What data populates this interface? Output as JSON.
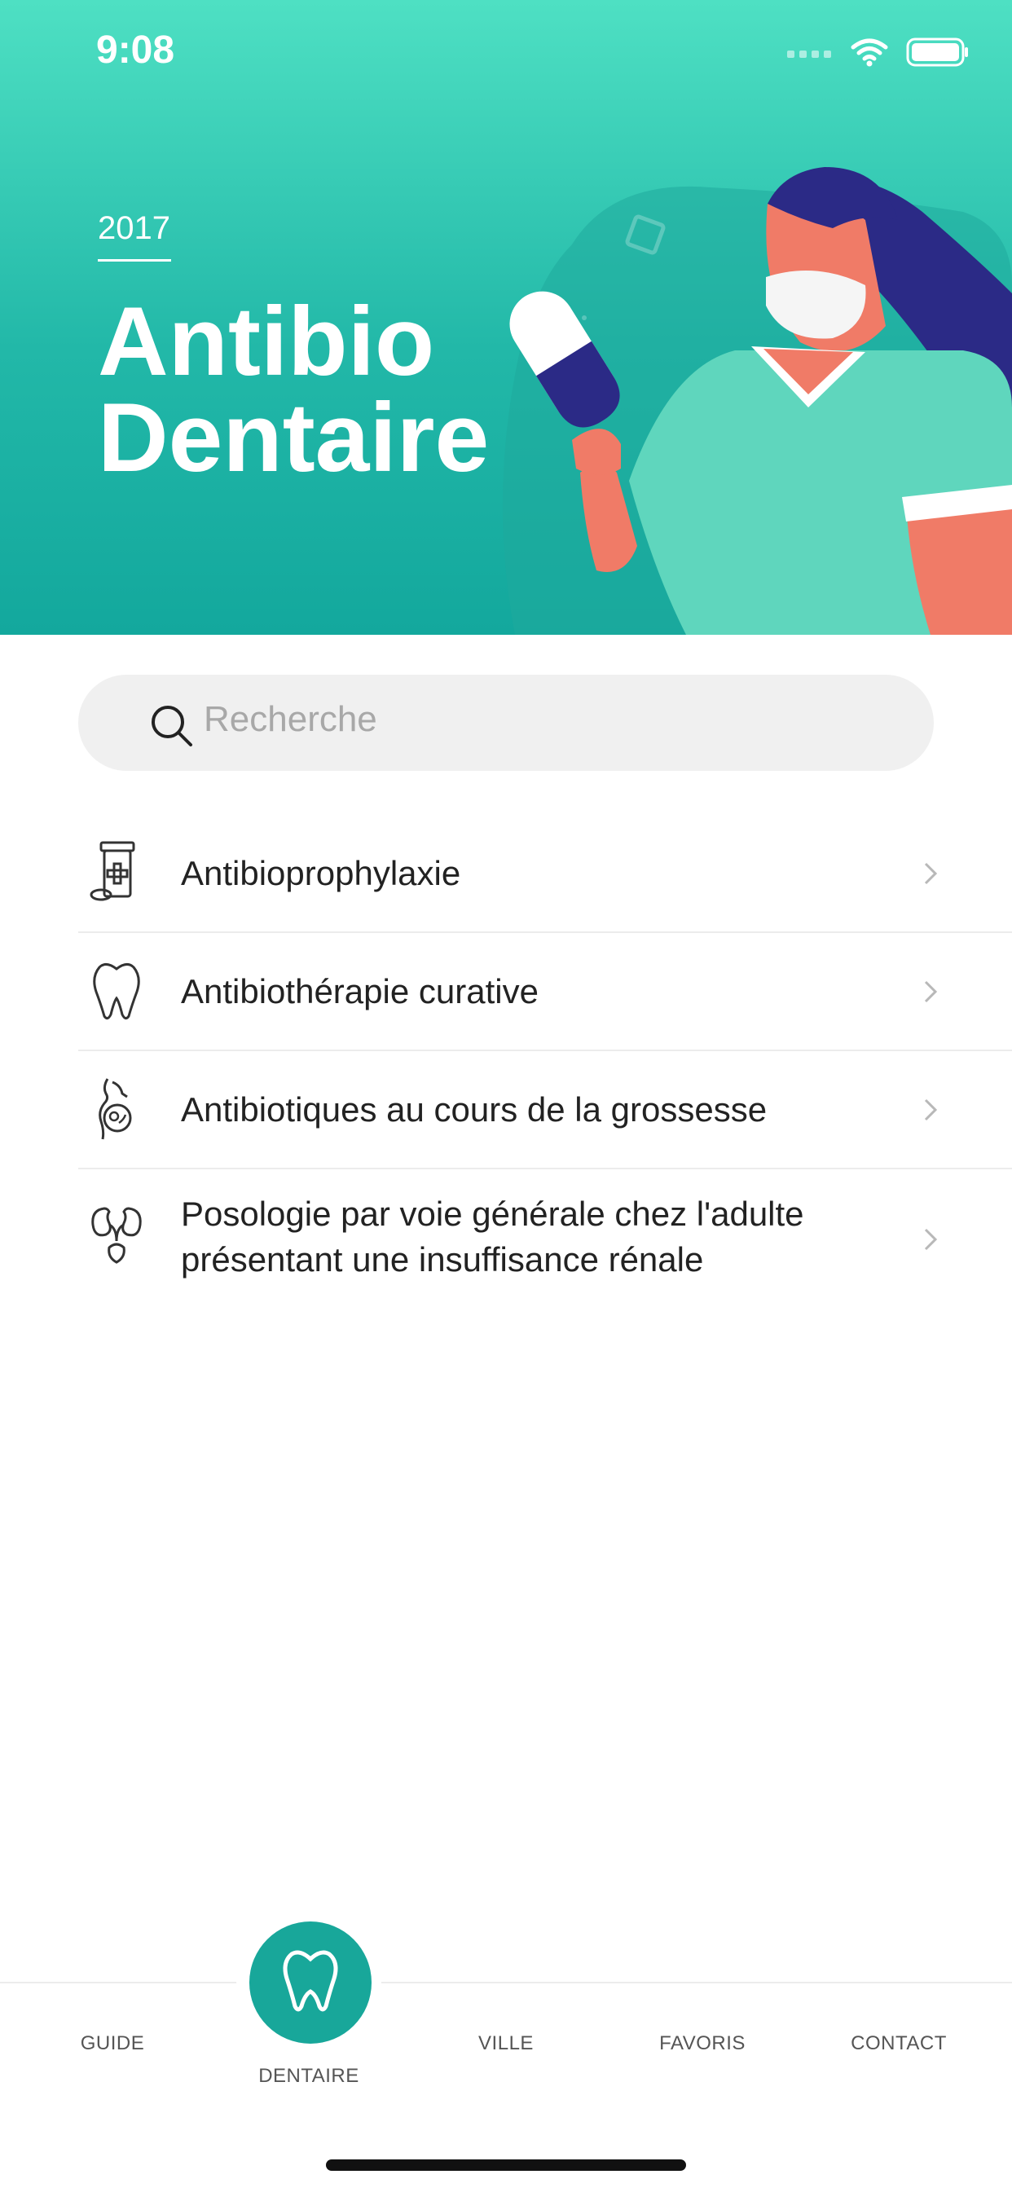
{
  "status": {
    "time": "9:08"
  },
  "header": {
    "year": "2017",
    "title_line1": "Antibio",
    "title_line2": "Dentaire"
  },
  "search": {
    "placeholder": "Recherche"
  },
  "menu": {
    "items": [
      {
        "label": "Antibioprophylaxie",
        "icon": "medicine-bottle-icon"
      },
      {
        "label": "Antibiothérapie curative",
        "icon": "tooth-icon"
      },
      {
        "label": "Antibiotiques au cours de la grossesse",
        "icon": "pregnancy-icon"
      },
      {
        "label": "Posologie par voie générale chez l'adulte présentant une insuffisance rénale",
        "icon": "kidney-icon"
      }
    ]
  },
  "tabs": {
    "guide": "GUIDE",
    "dentaire": "DENTAIRE",
    "ville": "VILLE",
    "favoris": "FAVORIS",
    "contact": "CONTACT"
  },
  "colors": {
    "accent": "#18a79a",
    "header_top": "#4ee0c3",
    "header_bottom": "#13a89d",
    "illustration_navy": "#2b2a86",
    "skin": "#f07b67"
  }
}
